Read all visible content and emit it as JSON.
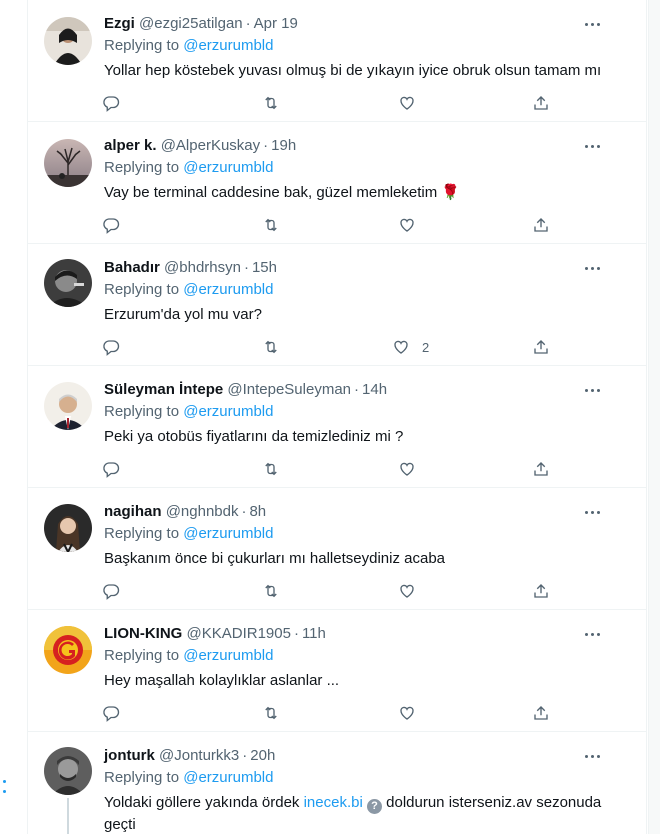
{
  "reply_prefix": "Replying to",
  "tweets": [
    {
      "name": "Ezgi",
      "handle": "@ezgi25atilgan",
      "time": "Apr 19",
      "mention": "@erzurumbld",
      "text": "Yollar hep köstebek yuvası olmuş bi de yıkayın iyice obruk olsun tamam mı",
      "likes": ""
    },
    {
      "name": "alper k.",
      "handle": "@AlperKuskay",
      "time": "19h",
      "mention": "@erzurumbld",
      "text": "Vay be terminal caddesine bak, güzel memleketim 🌹",
      "likes": ""
    },
    {
      "name": "Bahadır",
      "handle": "@bhdrhsyn",
      "time": "15h",
      "mention": "@erzurumbld",
      "text": "Erzurum'da yol mu var?",
      "likes": "2"
    },
    {
      "name": "Süleyman İntepe",
      "handle": "@IntepeSuleyman",
      "time": "14h",
      "mention": "@erzurumbld",
      "text": "Peki ya otobüs fiyatlarını da temizlediniz mi ?",
      "likes": ""
    },
    {
      "name": "nagihan",
      "handle": "@nghnbdk",
      "time": "8h",
      "mention": "@erzurumbld",
      "text": "Başkanım önce bi çukurları mı halletseydiniz acaba",
      "likes": ""
    },
    {
      "name": "LION-KING",
      "handle": "@KKADIR1905",
      "time": "11h",
      "mention": "@erzurumbld",
      "text": "Hey maşallah kolaylıklar aslanlar ...",
      "likes": ""
    },
    {
      "name": "jonturk",
      "handle": "@Jonturkk3",
      "time": "20h",
      "mention": "@erzurumbld",
      "text_before": "Yoldaki göllere yakında ördek",
      "link": "inecek.bi",
      "link_badge": "?",
      "text_after": "doldurun isterseniz.av sezonuda geçti",
      "likes": ""
    }
  ],
  "colors": {
    "accent": "#1d9bf0",
    "secondary": "#536471",
    "border": "#eff3f4"
  },
  "icons": [
    "reply-icon",
    "retweet-icon",
    "like-icon",
    "share-icon",
    "more-icon"
  ]
}
